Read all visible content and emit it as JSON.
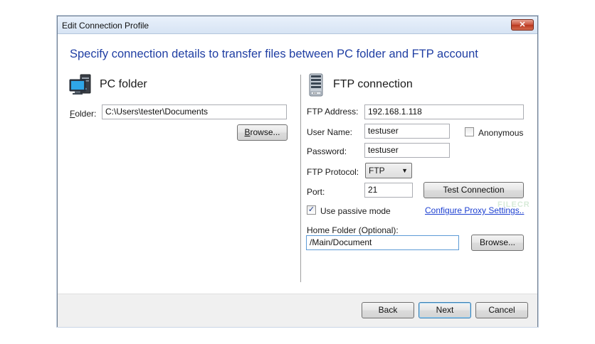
{
  "window": {
    "title": "Edit Connection Profile",
    "close_label": "✕"
  },
  "heading": "Specify connection details to transfer files between PC folder and FTP account",
  "pc": {
    "title": "PC folder",
    "folder_label_accel": "F",
    "folder_label_rest": "older:",
    "folder_value": "C:\\Users\\tester\\Documents",
    "browse_accel": "B",
    "browse_rest": "rowse..."
  },
  "ftp": {
    "title": "FTP connection",
    "address_label": "FTP Address:",
    "address_value": "192.168.1.118",
    "username_label": "User Name:",
    "username_value": "testuser",
    "anonymous_label": "Anonymous",
    "password_label": "Password:",
    "password_value": "testuser",
    "protocol_label": "FTP Protocol:",
    "protocol_value": "FTP",
    "port_label": "Port:",
    "port_value": "21",
    "test_button": "Test Connection",
    "passive_label": "Use passive mode",
    "passive_checked": "✓",
    "proxy_link": "Configure Proxy Settings..",
    "home_label": "Home Folder (Optional):",
    "home_value": "/Main/Document",
    "browse_label": "Browse..."
  },
  "footer": {
    "back": "Back",
    "next": "Next",
    "cancel": "Cancel"
  },
  "watermark": "FILECR"
}
